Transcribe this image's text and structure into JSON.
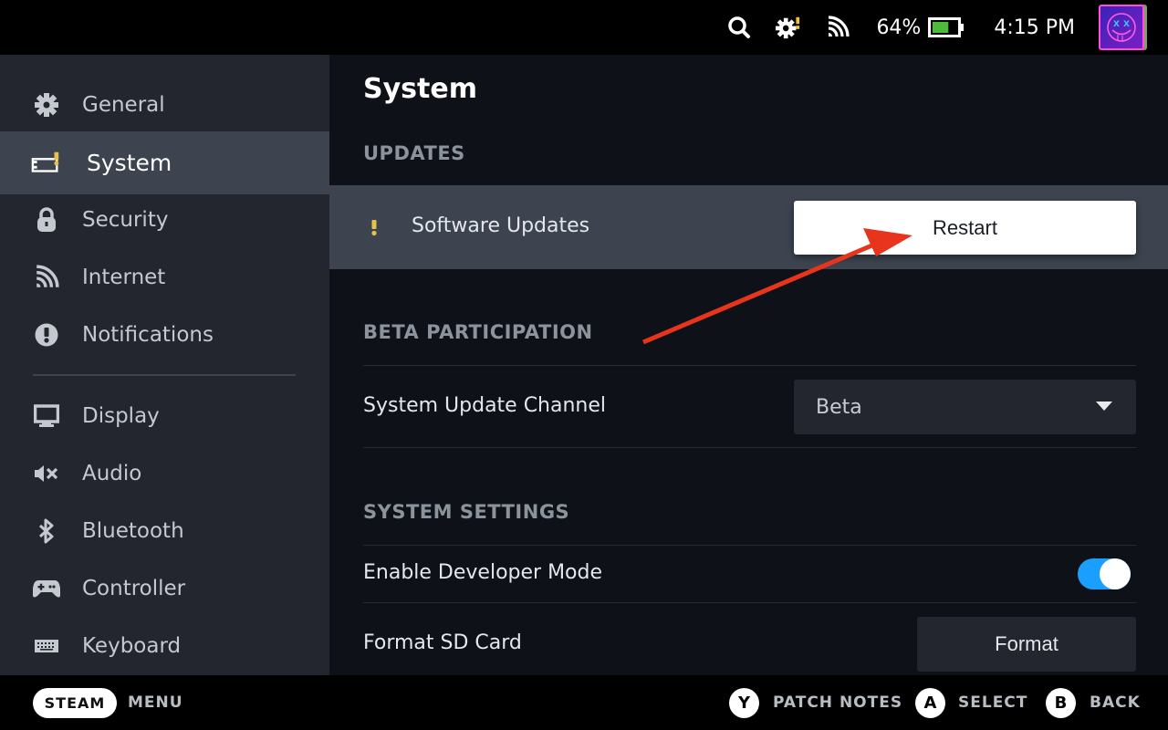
{
  "status_bar": {
    "battery_percent_label": "64%",
    "battery_level": 0.64,
    "time": "4:15 PM",
    "icons": [
      "search-icon",
      "settings-alert-icon",
      "wifi-icon",
      "battery-icon",
      "avatar"
    ]
  },
  "sidebar": {
    "items": [
      {
        "label": "General",
        "icon": "gear-icon"
      },
      {
        "label": "System",
        "icon": "system-alert-icon",
        "active": true
      },
      {
        "label": "Security",
        "icon": "lock-icon"
      },
      {
        "label": "Internet",
        "icon": "wifi-icon"
      },
      {
        "label": "Notifications",
        "icon": "exclamation-circle-icon"
      },
      {
        "label": "Display",
        "icon": "monitor-icon"
      },
      {
        "label": "Audio",
        "icon": "speaker-muted-icon"
      },
      {
        "label": "Bluetooth",
        "icon": "bluetooth-icon"
      },
      {
        "label": "Controller",
        "icon": "gamepad-icon"
      },
      {
        "label": "Keyboard",
        "icon": "keyboard-icon"
      }
    ]
  },
  "main": {
    "title": "System",
    "sections": {
      "updates": {
        "heading": "UPDATES",
        "software_updates_label": "Software Updates",
        "restart_button": "Restart"
      },
      "beta": {
        "heading": "BETA PARTICIPATION",
        "channel_label": "System Update Channel",
        "channel_value": "Beta"
      },
      "system_settings": {
        "heading": "SYSTEM SETTINGS",
        "developer_mode_label": "Enable Developer Mode",
        "developer_mode_on": true,
        "format_sd_label": "Format SD Card",
        "format_button": "Format"
      }
    }
  },
  "bottom_bar": {
    "steam": "STEAM",
    "menu": "MENU",
    "actions": [
      {
        "button": "Y",
        "label": "PATCH NOTES"
      },
      {
        "button": "A",
        "label": "SELECT"
      },
      {
        "button": "B",
        "label": "BACK"
      }
    ]
  },
  "colors": {
    "accent_blue": "#1a9fff",
    "warning_yellow": "#e8c04a",
    "annotation_arrow": "#e8341c"
  }
}
